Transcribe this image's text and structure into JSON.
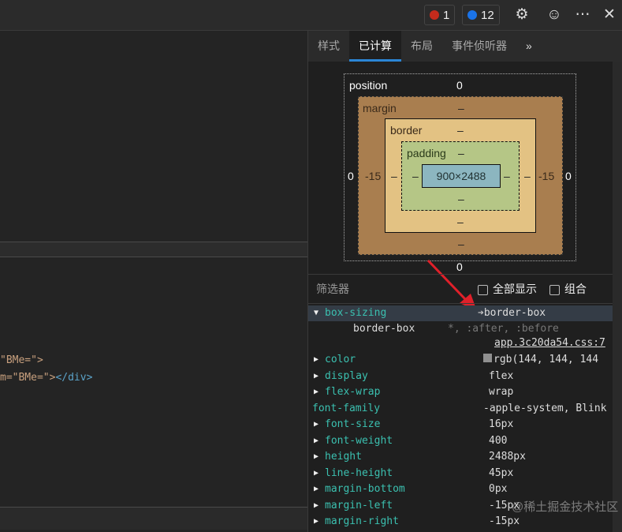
{
  "topbar": {
    "errors": "1",
    "messages": "12",
    "error_color": "#c42b1c",
    "message_color": "#1a73e8"
  },
  "tabs": [
    "样式",
    "已计算",
    "布局",
    "事件侦听器"
  ],
  "box_model": {
    "position_label": "position",
    "position_top": "0",
    "position_left": "0",
    "position_right": "0",
    "position_bottom": "0",
    "margin_label": "margin",
    "margin_top": "–",
    "margin_left": "-15",
    "margin_right": "-15",
    "margin_bottom": "–",
    "border_label": "border",
    "border_top": "–",
    "border_left": "–",
    "border_right": "–",
    "border_bottom": "–",
    "padding_label": "padding",
    "padding_top": "–",
    "padding_left": "–",
    "padding_right": "–",
    "padding_bottom": "–",
    "content": "900×2488"
  },
  "filter": {
    "label": "筛选器",
    "show_all": "全部显示",
    "group": "组合"
  },
  "code": {
    "line1": "\"BMe=\">",
    "line2_attr": "m=\"BMe=\">",
    "line2_tag": "</div>"
  },
  "expanded": {
    "name": "box-sizing",
    "value": "border-box",
    "sub_value": "border-box",
    "selector": "*, :after, :before",
    "source": "app.3c20da54.css:7"
  },
  "properties": [
    {
      "name": "color",
      "value": "rgb(144, 144, 144",
      "swatch": "#909090",
      "expand": true
    },
    {
      "name": "display",
      "value": "flex",
      "expand": true
    },
    {
      "name": "flex-wrap",
      "value": "wrap",
      "expand": true
    },
    {
      "name": "font-family",
      "value": "-apple-system, Blink",
      "expand": false
    },
    {
      "name": "font-size",
      "value": "16px",
      "expand": true
    },
    {
      "name": "font-weight",
      "value": "400",
      "expand": true
    },
    {
      "name": "height",
      "value": "2488px",
      "expand": true
    },
    {
      "name": "line-height",
      "value": "45px",
      "expand": true
    },
    {
      "name": "margin-bottom",
      "value": "0px",
      "expand": true
    },
    {
      "name": "margin-left",
      "value": "-15px",
      "expand": true
    },
    {
      "name": "margin-right",
      "value": "-15px",
      "expand": true
    }
  ],
  "watermark": "@稀土掘金技术社区"
}
